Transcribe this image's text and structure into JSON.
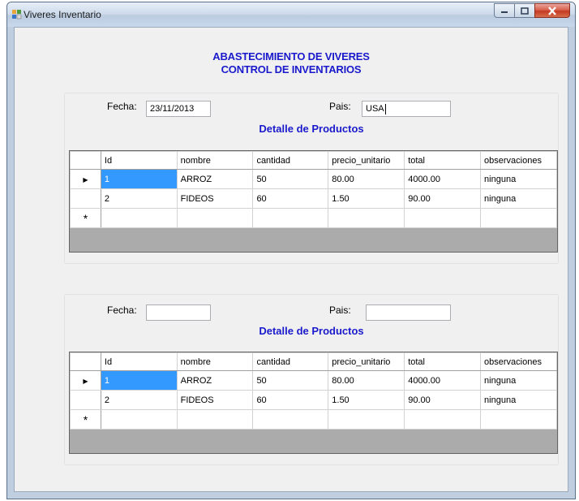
{
  "window": {
    "title": "Viveres Inventario"
  },
  "header": {
    "line1": "ABASTECIMIENTO DE VIVERES",
    "line2": "CONTROL DE INVENTARIOS"
  },
  "group1": {
    "fecha_label": "Fecha:",
    "fecha_value": "23/11/2013",
    "pais_label": "Pais:",
    "pais_value": "USA",
    "grid_title": "Detalle de Productos",
    "columns": [
      "Id",
      "nombre",
      "cantidad",
      "precio_unitario",
      "total",
      "observaciones"
    ],
    "rows": [
      [
        "1",
        "ARROZ",
        "50",
        "80.00",
        "4000.00",
        "ninguna"
      ],
      [
        "2",
        "FIDEOS",
        "60",
        "1.50",
        "90.00",
        "ninguna"
      ]
    ],
    "new_row_marker": "*",
    "current_row_marker": "▶"
  },
  "group2": {
    "fecha_label": "Fecha:",
    "fecha_value": "",
    "pais_label": "Pais:",
    "pais_value": "",
    "grid_title": "Detalle de Productos",
    "columns": [
      "Id",
      "nombre",
      "cantidad",
      "precio_unitario",
      "total",
      "observaciones"
    ],
    "rows": [
      [
        "1",
        "ARROZ",
        "50",
        "80.00",
        "4000.00",
        "ninguna"
      ],
      [
        "2",
        "FIDEOS",
        "60",
        "1.50",
        "90.00",
        "ninguna"
      ]
    ],
    "new_row_marker": "*",
    "current_row_marker": "▶"
  },
  "colors": {
    "heading": "#1a1acc",
    "selection": "#3399ff",
    "grid_background": "#ababab"
  }
}
